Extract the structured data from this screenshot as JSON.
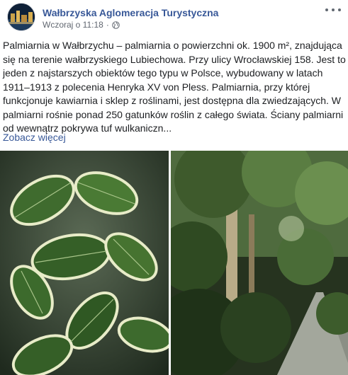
{
  "post": {
    "page_name": "Wałbrzyska Aglomeracja Turystyczna",
    "timestamp": "Wczoraj o 11:18",
    "separator": "·",
    "privacy_icon": "globe-icon",
    "more_icon": "more-options-icon",
    "text": "Palmiarnia w Wałbrzychu – palmiarnia o powierzchni ok. 1900 m², znajdująca się na terenie wałbrzyskiego Lubiechowa. Przy ulicy Wrocławskiej 158. Jest to jeden z najstarszych obiektów tego typu w Polsce, wybudowany w latach 1911–1913 z polecenia Henryka XV von Pless. Palmiarnia, przy której funkcjonuje kawiarnia i sklep z roślinami, jest dostępna dla zwiedzających. W palmiarni rośnie ponad 250 gatunków roślin z całego świata. Ściany palmiarni od wewnątrz pokrywa tuf wulkaniczn...",
    "see_more": "Zobacz więcej"
  },
  "colors": {
    "link": "#385898",
    "text": "#1c1e21",
    "meta": "#616770"
  }
}
